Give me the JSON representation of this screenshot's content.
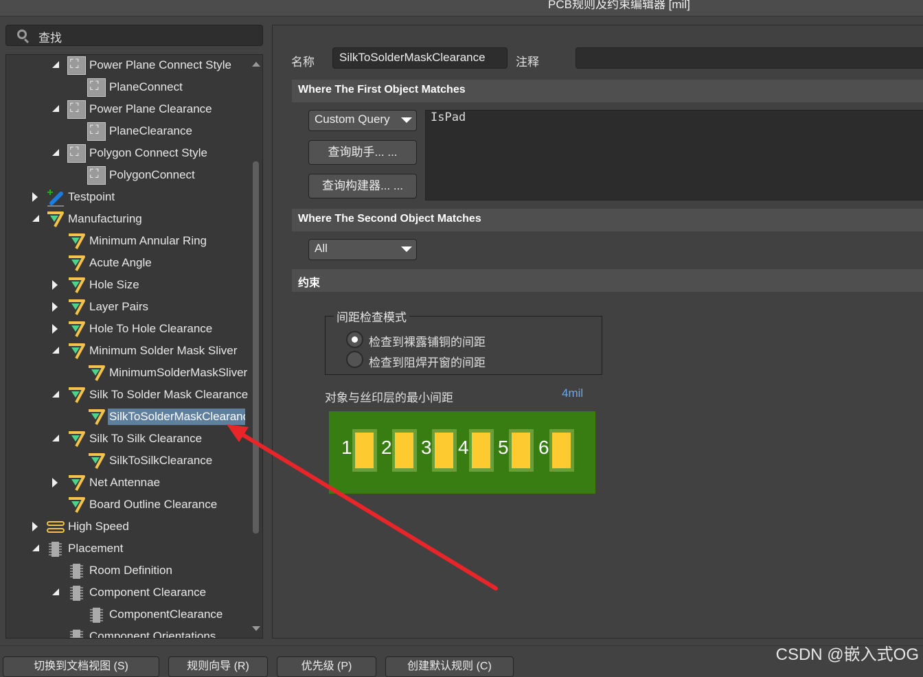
{
  "window": {
    "title": "PCB规则及约束编辑器 [mil]"
  },
  "search": {
    "placeholder": "查找"
  },
  "tree": [
    {
      "label": "Power Plane Connect Style",
      "level": 2,
      "arrow": "open",
      "icon": "plane"
    },
    {
      "label": "PlaneConnect",
      "level": 3,
      "arrow": "none",
      "icon": "plane"
    },
    {
      "label": "Power Plane Clearance",
      "level": 2,
      "arrow": "open",
      "icon": "plane"
    },
    {
      "label": "PlaneClearance",
      "level": 3,
      "arrow": "none",
      "icon": "plane"
    },
    {
      "label": "Polygon Connect Style",
      "level": 2,
      "arrow": "open",
      "icon": "plane"
    },
    {
      "label": "PolygonConnect",
      "level": 3,
      "arrow": "none",
      "icon": "plane"
    },
    {
      "label": "Testpoint",
      "level": 1,
      "arrow": "closed",
      "icon": "testpoint"
    },
    {
      "label": "Manufacturing",
      "level": 1,
      "arrow": "open",
      "icon": "manufacturing"
    },
    {
      "label": "Minimum Annular Ring",
      "level": 2,
      "arrow": "none",
      "icon": "manufacturing"
    },
    {
      "label": "Acute Angle",
      "level": 2,
      "arrow": "none",
      "icon": "manufacturing"
    },
    {
      "label": "Hole Size",
      "level": 2,
      "arrow": "closed",
      "icon": "manufacturing"
    },
    {
      "label": "Layer Pairs",
      "level": 2,
      "arrow": "closed",
      "icon": "manufacturing"
    },
    {
      "label": "Hole To Hole Clearance",
      "level": 2,
      "arrow": "closed",
      "icon": "manufacturing"
    },
    {
      "label": "Minimum Solder Mask Sliver",
      "level": 2,
      "arrow": "open",
      "icon": "manufacturing"
    },
    {
      "label": "MinimumSolderMaskSliver",
      "level": 3,
      "arrow": "none",
      "icon": "manufacturing"
    },
    {
      "label": "Silk To Solder Mask Clearance",
      "level": 2,
      "arrow": "open",
      "icon": "manufacturing"
    },
    {
      "label": "SilkToSolderMaskClearance",
      "level": 3,
      "arrow": "none",
      "icon": "manufacturing",
      "selected": true
    },
    {
      "label": "Silk To Silk Clearance",
      "level": 2,
      "arrow": "open",
      "icon": "manufacturing"
    },
    {
      "label": "SilkToSilkClearance",
      "level": 3,
      "arrow": "none",
      "icon": "manufacturing"
    },
    {
      "label": "Net Antennae",
      "level": 2,
      "arrow": "closed",
      "icon": "manufacturing"
    },
    {
      "label": "Board Outline Clearance",
      "level": 2,
      "arrow": "none",
      "icon": "manufacturing"
    },
    {
      "label": "High Speed",
      "level": 1,
      "arrow": "closed",
      "icon": "high-speed"
    },
    {
      "label": "Placement",
      "level": 1,
      "arrow": "open",
      "icon": "placement"
    },
    {
      "label": "Room Definition",
      "level": 2,
      "arrow": "none",
      "icon": "placement"
    },
    {
      "label": "Component Clearance",
      "level": 2,
      "arrow": "open",
      "icon": "placement"
    },
    {
      "label": "ComponentClearance",
      "level": 3,
      "arrow": "none",
      "icon": "placement"
    },
    {
      "label": "Component Orientations",
      "level": 2,
      "arrow": "none",
      "icon": "placement"
    }
  ],
  "form": {
    "name_label": "名称",
    "name_value": "SilkToSolderMaskClearance",
    "comment_label": "注释",
    "comment_value": "",
    "first_header": "Where The First Object Matches",
    "first_query_type": "Custom Query",
    "query_helper": "查询助手... ...",
    "query_builder": "查询构建器... ...",
    "query_text": "IsPad",
    "second_header": "Where The Second Object Matches",
    "second_query_type": "All",
    "constraints_header": "约束",
    "mode_group": "间距检查模式",
    "mode_options": [
      "检查到裸露铺铜的间距",
      "检查到阻焊开窗的间距"
    ],
    "mode_selected": 0,
    "min_clearance_label": "对象与丝印层的最小间距",
    "min_clearance_value": "4mil",
    "pad_numbers": [
      "1",
      "2",
      "3",
      "4",
      "5",
      "6"
    ]
  },
  "bottom_buttons": [
    "切换到文档视图 (S)",
    "规则向导 (R)",
    "优先级 (P)",
    "创建默认规则 (C)"
  ],
  "watermark": "CSDN @嵌入式OG",
  "colors": {
    "selection": "#5f7f9f",
    "pcb": "#377d12",
    "pad": "#fdca2f",
    "accent_value": "#6fa8e8",
    "arrow": "#e8262a"
  }
}
